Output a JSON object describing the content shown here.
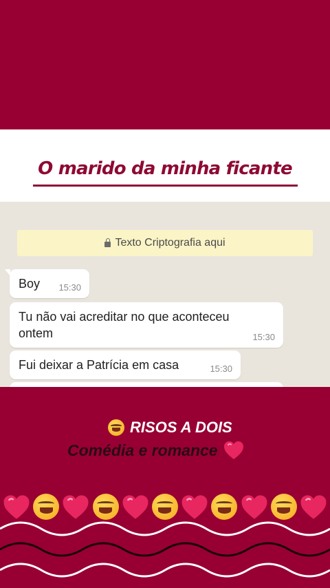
{
  "title": "O marido da minha ficante",
  "chat": {
    "encryption_banner": "Texto Criptografia aqui",
    "messages": [
      {
        "text": "Boy",
        "time": "15:30"
      },
      {
        "text": "Tu não vai acreditar no que aconteceu ontem",
        "time": "15:30"
      },
      {
        "text": "Fui deixar a Patrícia em casa",
        "time": "15:30"
      }
    ]
  },
  "brand": {
    "name": "RISOS A DOIS",
    "tagline": "Comédia e romance"
  },
  "emoji_row": [
    "heart-icon",
    "laughing-icon",
    "heart-icon",
    "laughing-icon",
    "heart-icon",
    "laughing-icon",
    "heart-icon",
    "laughing-icon",
    "heart-icon",
    "laughing-icon",
    "heart-icon"
  ],
  "colors": {
    "background": "#980033",
    "title": "#8e0a33",
    "chat_bg": "#e9e5dd",
    "banner": "#fbf4c6",
    "heart": "#e8265f"
  }
}
